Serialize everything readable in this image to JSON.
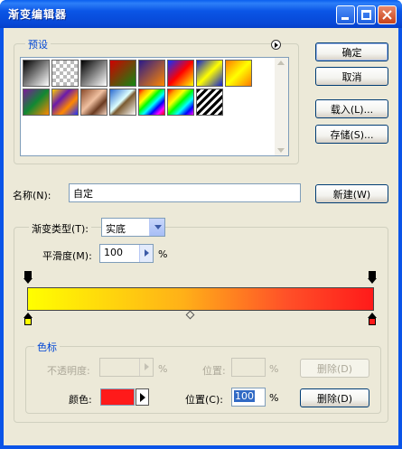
{
  "window": {
    "title": "渐变编辑器"
  },
  "presets": {
    "label": "预设",
    "swatches": [
      {
        "id": "black-white",
        "bg": "linear-gradient(135deg,#000 0%,#fff 100%)"
      },
      {
        "id": "black-transparent",
        "bg": "repeating-conic-gradient(#bbb 0% 25%, #fff 0% 50%) 0 0/8px 8px"
      },
      {
        "id": "foreground-background",
        "bg": "linear-gradient(135deg,#000 0%,#fff 100%)"
      },
      {
        "id": "red-green",
        "bg": "linear-gradient(135deg,#d00000 0%,#118811 100%)"
      },
      {
        "id": "violet-orange",
        "bg": "linear-gradient(135deg,#2a1a8a 0%,#ff8800 100%)"
      },
      {
        "id": "blue-red-yellow",
        "bg": "linear-gradient(135deg,#1030ff 0%,#ff0000 50%,#ffff00 100%)"
      },
      {
        "id": "blue-yellow-blue",
        "bg": "linear-gradient(135deg,#1020d0 0%,#ffff00 50%,#1020d0 100%)"
      },
      {
        "id": "orange-yellow",
        "bg": "linear-gradient(135deg,#ff7a00 0%,#ffff00 50%,#ff7a00 100%)"
      },
      {
        "id": "violet-green-orange",
        "bg": "linear-gradient(135deg,#7a1a9a 0%,#118833 50%,#ff8800 100%)"
      },
      {
        "id": "yellow-violet-orange-blue",
        "bg": "linear-gradient(135deg,#ffd000 0%,#6a1aaa 35%,#ff8800 65%,#2030ff 100%)"
      },
      {
        "id": "copper",
        "bg": "linear-gradient(135deg,#8a4a2a 0%,#f0c0a0 45%,#6a3a20 70%,#f5d5c0 100%)"
      },
      {
        "id": "chrome",
        "bg": "linear-gradient(135deg,#2a6ad0 0%,#dff 45%,#7a5a30 55%,#fff 100%)"
      },
      {
        "id": "spectrum",
        "bg": "linear-gradient(135deg,red,orange,yellow,lime,cyan,blue,magenta,red)"
      },
      {
        "id": "transparent-rainbow",
        "bg": "linear-gradient(135deg,red,orange,yellow,lime,cyan,blue,magenta)"
      },
      {
        "id": "transparent-stripes",
        "bg": "repeating-linear-gradient(135deg,#000 0 3px,#fff 3px 6px)"
      }
    ]
  },
  "buttons": {
    "ok": "确定",
    "cancel": "取消",
    "load": "载入(L)...",
    "save": "存储(S)...",
    "new": "新建(W)",
    "delete_opacity": "删除(D)",
    "delete_color": "删除(D)"
  },
  "name_field": {
    "label": "名称(N):",
    "value": "自定"
  },
  "gradient": {
    "type_label": "渐变类型(T):",
    "type_value": "实底",
    "smooth_label": "平滑度(M):",
    "smooth_value": "100",
    "smooth_unit": "%",
    "start_color": "#ffff00",
    "end_color": "#ff1a1a"
  },
  "stops": {
    "label": "色标",
    "opacity_label": "不透明度:",
    "opacity_unit": "%",
    "opacity_location_label": "位置:",
    "opacity_location_unit": "%",
    "color_label": "颜色:",
    "color_value": "#ff1a1a",
    "color_location_label": "位置(C):",
    "color_location_value": "100",
    "color_location_unit": "%"
  }
}
